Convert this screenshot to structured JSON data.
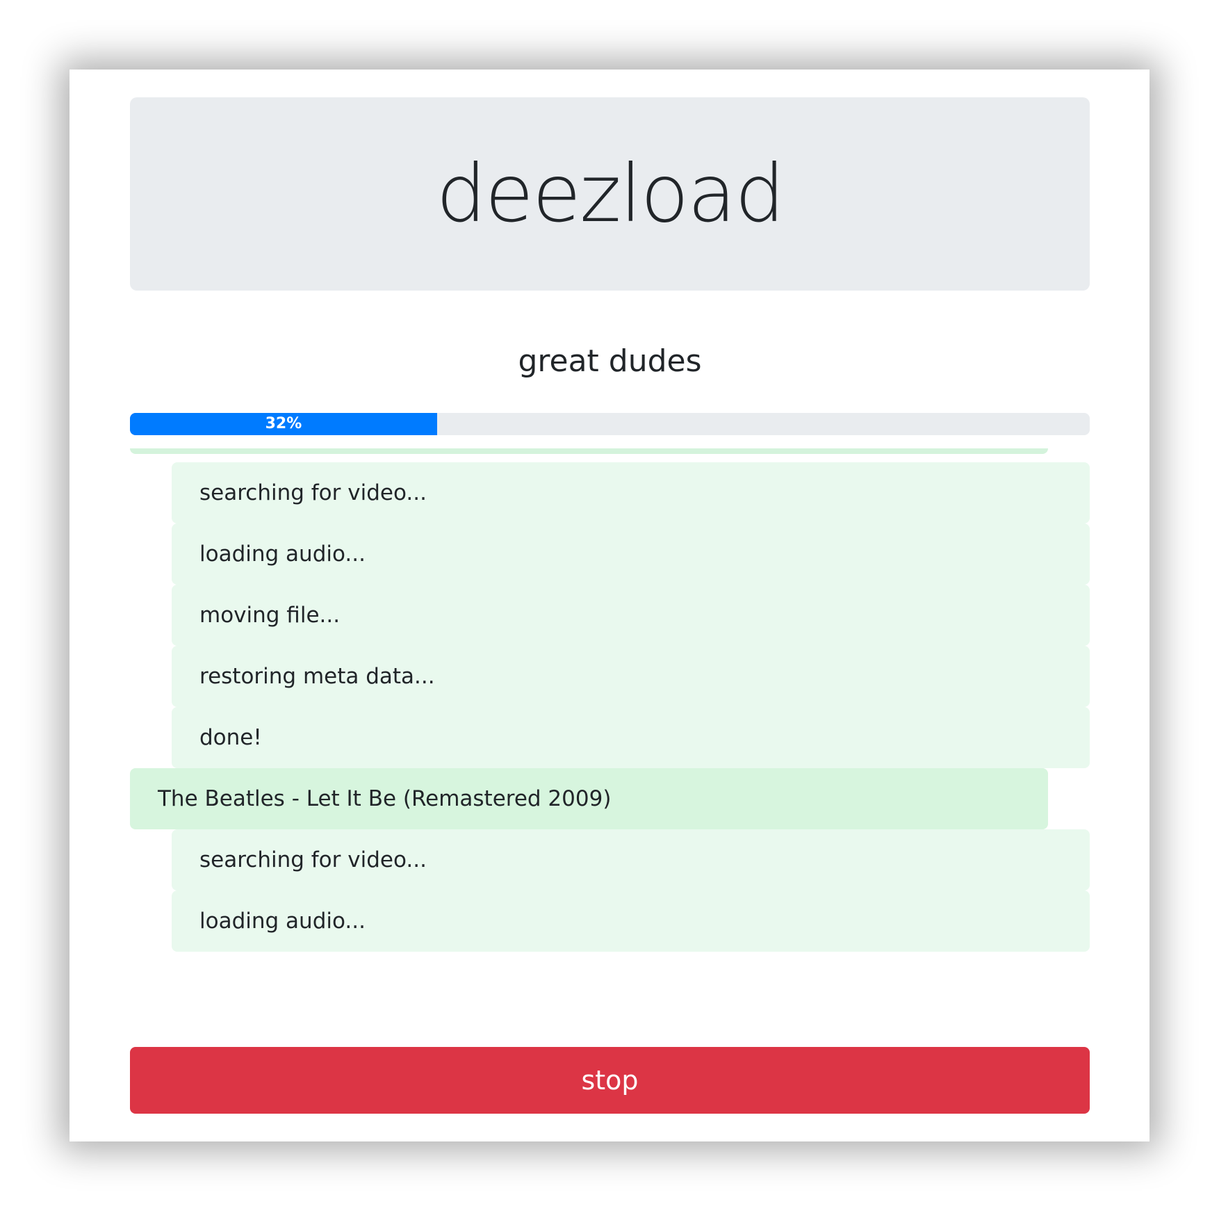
{
  "app": {
    "title": "deezload"
  },
  "playlist": {
    "name": "great dudes"
  },
  "progress": {
    "value": 32,
    "label": "32%",
    "color": "#007bff"
  },
  "log": {
    "entries": [
      {
        "kind": "step",
        "text": "searching for video..."
      },
      {
        "kind": "step",
        "text": "loading audio..."
      },
      {
        "kind": "step",
        "text": "moving file..."
      },
      {
        "kind": "step",
        "text": "restoring meta data..."
      },
      {
        "kind": "step",
        "text": "done!"
      },
      {
        "kind": "track",
        "text": "The Beatles - Let It Be (Remastered 2009)"
      },
      {
        "kind": "step",
        "text": "searching for video..."
      },
      {
        "kind": "step",
        "text": "loading audio..."
      }
    ]
  },
  "controls": {
    "stop_label": "stop",
    "stop_color": "#dc3545"
  }
}
